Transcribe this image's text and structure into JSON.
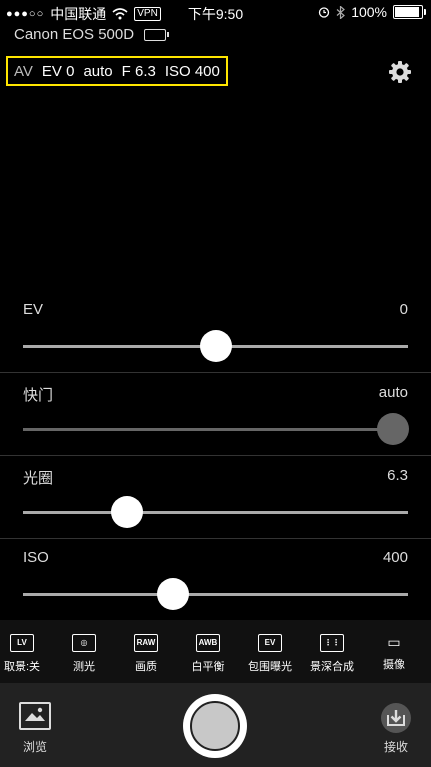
{
  "status_bar": {
    "signal": "●●●○○",
    "carrier": "中国联通",
    "vpn": "VPN",
    "time": "下午9:50",
    "battery": "100%",
    "battery_level": 1.0
  },
  "camera": {
    "name": "Canon EOS 500D"
  },
  "summary": {
    "mode": "AV",
    "ev": "EV 0",
    "shutter": "auto",
    "aperture": "F 6.3",
    "iso": "ISO 400"
  },
  "sliders": [
    {
      "label": "EV",
      "value": "0",
      "position": 0.5,
      "dim": false
    },
    {
      "label": "快门",
      "value": "auto",
      "position": 0.96,
      "dim": true
    },
    {
      "label": "光圈",
      "value": "6.3",
      "position": 0.27,
      "dim": false
    },
    {
      "label": "ISO",
      "value": "400",
      "position": 0.39,
      "dim": false
    }
  ],
  "toolbar": [
    {
      "icon_text": "LV",
      "label": "取景:关"
    },
    {
      "icon_text": "◎",
      "label": "测光"
    },
    {
      "icon_text": "RAW",
      "label": "画质"
    },
    {
      "icon_text": "AWB",
      "label": "白平衡"
    },
    {
      "icon_text": "EV",
      "label": "包围曝光"
    },
    {
      "icon_text": "⋮⋮",
      "label": "景深合成"
    },
    {
      "icon_text": "▭",
      "label": "摄像"
    }
  ],
  "bottom": {
    "browse_label": "浏览",
    "receive_label": "接收"
  }
}
